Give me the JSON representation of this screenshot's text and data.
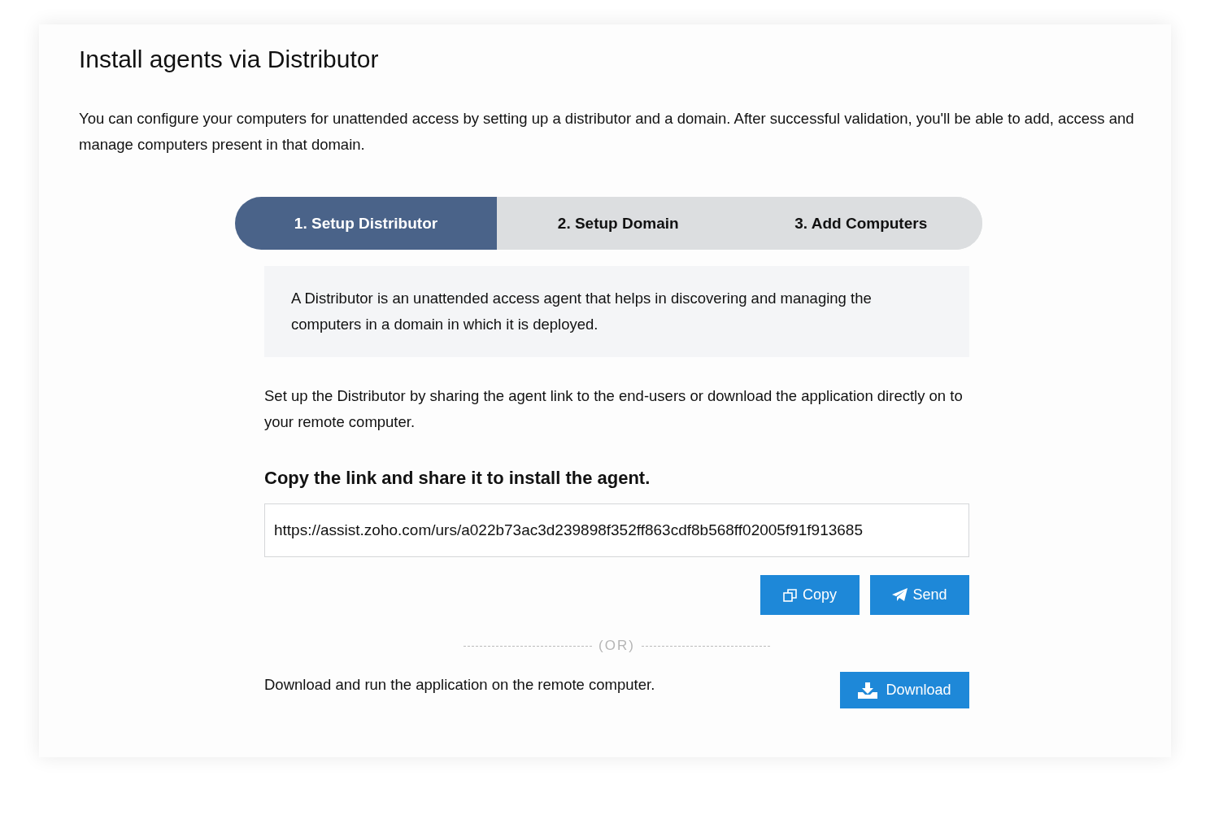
{
  "title": "Install agents via Distributor",
  "intro": "You can configure your computers for unattended access by setting up a distributor and a domain. After successful validation, you'll be able to add, access and manage computers present in that domain.",
  "steps": [
    {
      "label": "1. Setup Distributor",
      "selected": true
    },
    {
      "label": "2. Setup Domain",
      "selected": false
    },
    {
      "label": "3. Add Computers",
      "selected": false
    }
  ],
  "info": "A Distributor is an unattended access agent that helps in discovering and managing the computers in a domain in which it is deployed.",
  "setup_text": "Set up the Distributor by sharing the agent link to the end-users or download the application directly on to your remote computer.",
  "link_heading": "Copy the link and share it to install the agent.",
  "link_field": {
    "value": "https://assist.zoho.com/urs/a022b73ac3d239898f352ff863cdf8b568ff02005f91f913685"
  },
  "buttons": [
    {
      "kind": "copy",
      "label": "Copy"
    },
    {
      "kind": "send",
      "label": "Send"
    }
  ],
  "separator": "(OR)",
  "download_text": "Download and run the application on the remote computer.",
  "download_button": {
    "kind": "download",
    "label": "Download"
  }
}
